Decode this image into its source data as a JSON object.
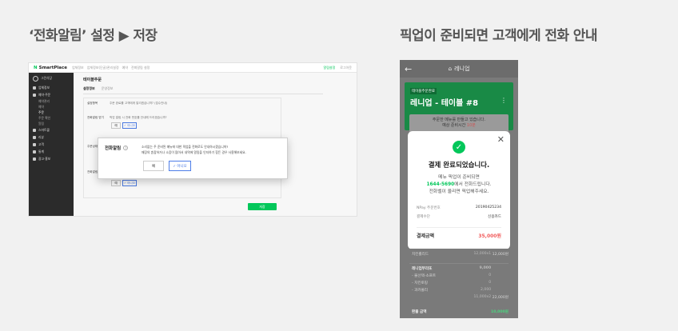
{
  "headings": {
    "left": "‘전화알림’ 설정 ▶ 저장",
    "right": "픽업이 준비되면 고객에게 전화 안내"
  },
  "admin": {
    "brand": "SmartPlace",
    "crumbs": [
      "업체정보",
      "업체정보(단골)관리설정",
      "예약",
      "전화알림 설정"
    ],
    "top_right": [
      "알림설정",
      "로그아웃"
    ],
    "sidebar": {
      "profile": "그린식당",
      "items": [
        "업체정보",
        "예약·주문"
      ],
      "subs": [
        "예약관리",
        "예약",
        "주문",
        "주문 확인",
        "알림"
      ],
      "items2": [
        "스마트콜",
        "리뷰",
        "고객",
        "통계",
        "광고·홍보"
      ]
    },
    "page_title": "테이블주문",
    "tabs": [
      "설정정보",
      "운영정보"
    ],
    "rows": [
      {
        "label": "설정항목",
        "desc": "주문 완료를 고객에게 알리겠습니까? (접수안내)"
      },
      {
        "label": "전화알림 받기",
        "desc": "픽업 알림 시 전화 번호를 안내해 드리겠습니까?"
      },
      {
        "label": "주문상태",
        "desc": ""
      },
      {
        "label": "전화알림",
        "desc": ""
      }
    ],
    "btn_yes": "예",
    "btn_no": "✓ 아니오",
    "save": "저장",
    "dialog": {
      "title": "전화알림",
      "help": "?",
      "line1": "소리없는 주 준비된 메뉴에 대한 픽업을 전화로도 안내하시겠습니까?",
      "line2": "매장의 혼잡하거나 소음이 많아서 내역에 알림을 인지하기 힘든 경우 사용해보세요.",
      "yes": "예",
      "no": "✓ 아니오"
    }
  },
  "phone": {
    "back": "←",
    "title": "레니업",
    "badge": "테이블주문완료",
    "store": "레니업 - 테이블 #8",
    "more": "⋮",
    "prep1": "주문한 메뉴를 만들고 있습니다.",
    "prep2": "예상 준비시간 ",
    "prep2_red": "10분",
    "close": "✕",
    "check": "✓",
    "modal_title": "결제 완료되었습니다.",
    "m1": "메뉴 픽업이 준비되면",
    "m2_phone": "1644-5690",
    "m2_rest": "에서 전화드립니다.",
    "m3": "전화벨이 울리면 픽업해주세요.",
    "kv": [
      {
        "k": "NPay 주문번호",
        "v": "20190425234"
      },
      {
        "k": "결제수단",
        "v": "신용카드"
      }
    ],
    "total_label": "결제금액",
    "total_value": "35,000원",
    "items": [
      {
        "a": "치킨롤리드",
        "b": "12,000x1",
        "c": "12,000원"
      },
      {
        "a": "레니업부리또",
        "b": "9,000",
        "c": ""
      },
      {
        "a": " - 물선택-소프트",
        "b": "0",
        "c": ""
      },
      {
        "a": " - 치킨토핑",
        "b": "0",
        "c": ""
      },
      {
        "a": " - 과카몰리",
        "b": "2,000",
        "c": ""
      },
      {
        "a": "",
        "b": "11,000x2",
        "c": "22,000원"
      }
    ],
    "footer_label": "환불 금액",
    "footer_value": "10,000원"
  }
}
